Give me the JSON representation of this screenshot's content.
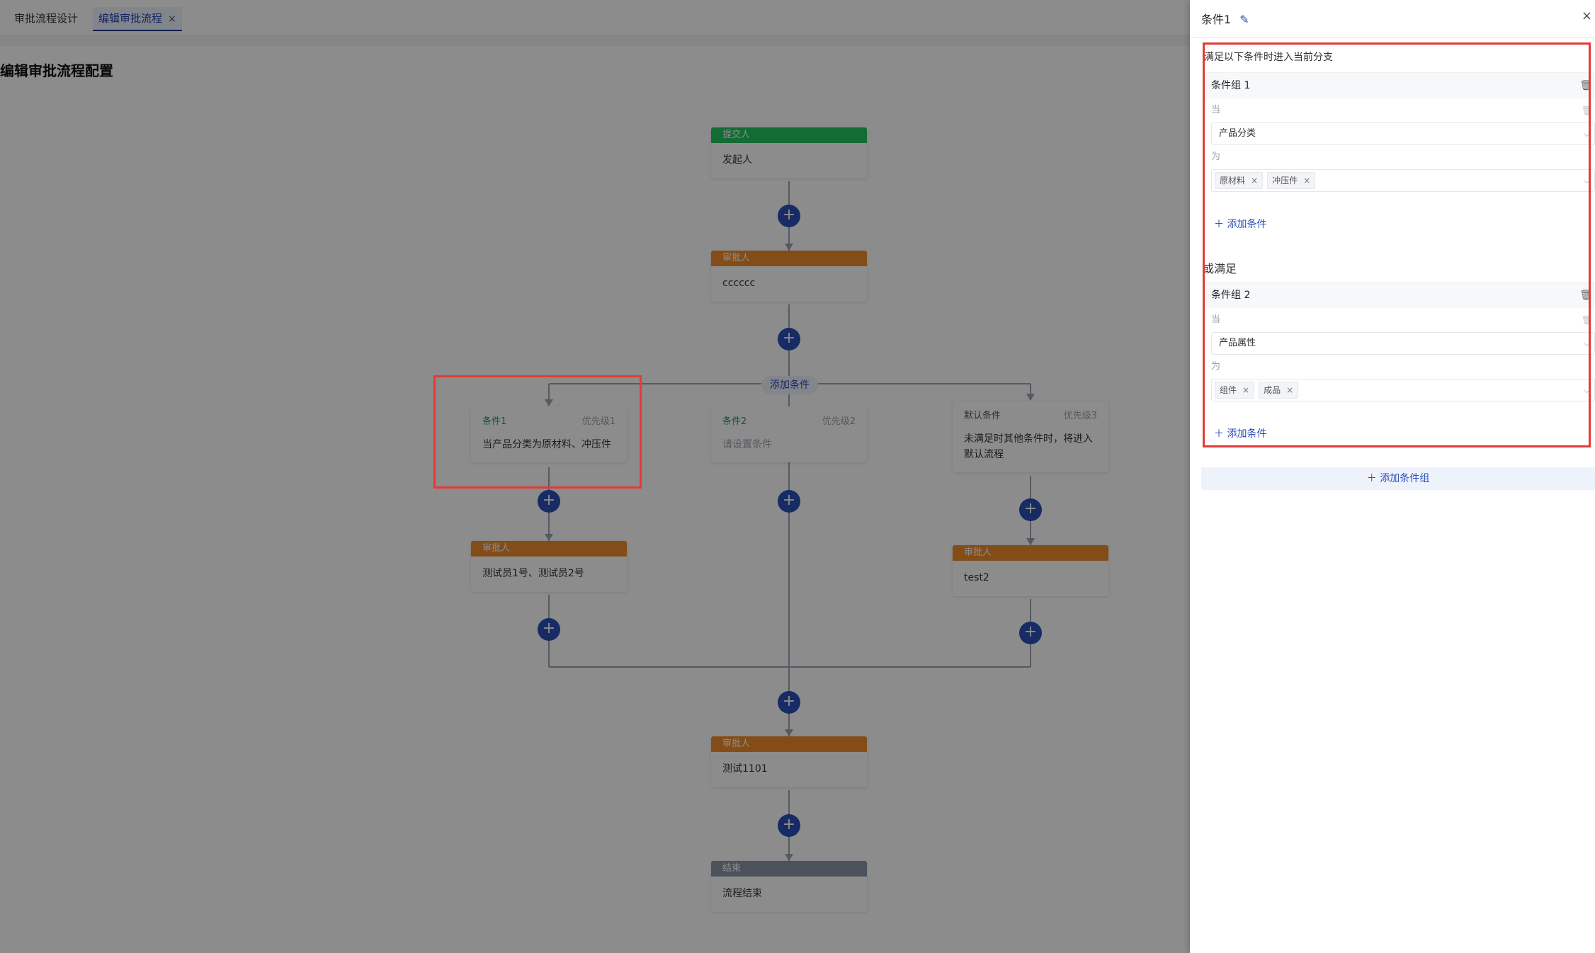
{
  "tabs": [
    {
      "label": "审批流程设计"
    },
    {
      "label": "编辑审批流程",
      "close": "×"
    }
  ],
  "page_title": "编辑审批流程配置",
  "flow": {
    "submitter": {
      "header": "提交人",
      "body": "发起人"
    },
    "approver1": {
      "header": "审批人",
      "body": "cccccc"
    },
    "add_condition": "添加条件",
    "plus_glyph": "+",
    "branches": [
      {
        "name": "条件1",
        "priority": "优先级1",
        "body": "当产品分类为原材料、冲压件"
      },
      {
        "name": "条件2",
        "priority": "优先级2",
        "body": "请设置条件"
      },
      {
        "name": "默认条件",
        "priority": "优先级3",
        "body": "未满足时其他条件时，将进入默认流程"
      }
    ],
    "branch_approver_left": {
      "header": "审批人",
      "body": "测试员1号、测试员2号"
    },
    "branch_approver_right": {
      "header": "审批人",
      "body": "test2"
    },
    "approver_final": {
      "header": "审批人",
      "body": "测试1101"
    },
    "end": {
      "header": "结束",
      "body": "流程结束"
    }
  },
  "drawer": {
    "title": "条件1",
    "edit_icon": "✎",
    "close_icon": "×",
    "hint": "满足以下条件时进入当前分支",
    "or_label": "或满足",
    "groups": [
      {
        "title": "条件组 1",
        "when_label": "当",
        "field": "产品分类",
        "is_label": "为",
        "values": [
          "原材料",
          "冲压件"
        ],
        "add_condition": "添加条件"
      },
      {
        "title": "条件组 2",
        "when_label": "当",
        "field": "产品属性",
        "is_label": "为",
        "values": [
          "组件",
          "成品"
        ],
        "add_condition": "添加条件"
      }
    ],
    "add_group": "添加条件组"
  },
  "colors": {
    "accent": "#2b4fb8",
    "submitter": "#22c55e",
    "approver": "#f08c2d",
    "end": "#8b95a7",
    "highlight": "#e53935"
  }
}
